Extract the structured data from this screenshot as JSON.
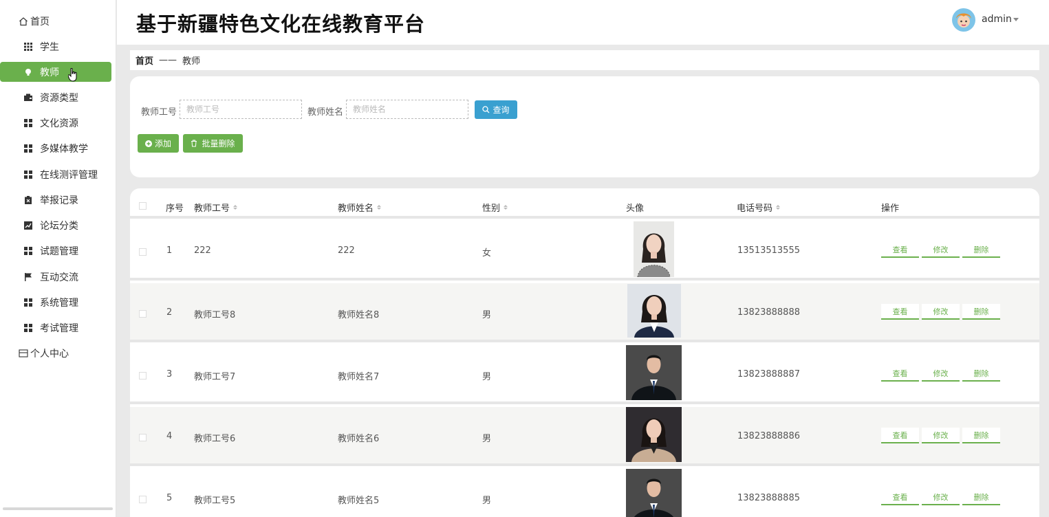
{
  "app": {
    "title": "基于新疆特色文化在线教育平台",
    "username": "admin"
  },
  "sidebar": {
    "items": [
      {
        "label": "首页",
        "icon": "home-icon"
      },
      {
        "label": "学生",
        "icon": "grid-icon"
      },
      {
        "label": "教师",
        "icon": "bulb-icon",
        "active": true
      },
      {
        "label": "资源类型",
        "icon": "wallet-icon"
      },
      {
        "label": "文化资源",
        "icon": "apps-icon"
      },
      {
        "label": "多媒体教学",
        "icon": "apps-icon"
      },
      {
        "label": "在线测评管理",
        "icon": "apps-icon"
      },
      {
        "label": "举报记录",
        "icon": "clipboard-icon"
      },
      {
        "label": "论坛分类",
        "icon": "chart-icon"
      },
      {
        "label": "试题管理",
        "icon": "apps-icon"
      },
      {
        "label": "互动交流",
        "icon": "flag-icon"
      },
      {
        "label": "系统管理",
        "icon": "apps-icon"
      },
      {
        "label": "考试管理",
        "icon": "apps-icon"
      },
      {
        "label": "个人中心",
        "icon": "id-card-icon"
      }
    ]
  },
  "breadcrumb": {
    "home": "首页",
    "separator": "——",
    "current": "教师"
  },
  "search": {
    "id_label": "教师工号",
    "id_placeholder": "教师工号",
    "id_value": "",
    "name_label": "教师姓名",
    "name_placeholder": "教师姓名",
    "name_value": "",
    "query_label": "查询"
  },
  "actions": {
    "add_label": "添加",
    "batch_delete_label": "批量删除"
  },
  "table": {
    "headers": {
      "index": "序号",
      "id": "教师工号",
      "name": "教师姓名",
      "gender": "性别",
      "avatar": "头像",
      "phone": "电话号码",
      "ops": "操作"
    },
    "op_labels": {
      "view": "查看",
      "edit": "修改",
      "delete": "删除"
    },
    "rows": [
      {
        "index": "1",
        "id": "222",
        "name": "222",
        "gender": "女",
        "phone": "13513513555"
      },
      {
        "index": "2",
        "id": "教师工号8",
        "name": "教师姓名8",
        "gender": "男",
        "phone": "13823888888"
      },
      {
        "index": "3",
        "id": "教师工号7",
        "name": "教师姓名7",
        "gender": "男",
        "phone": "13823888887"
      },
      {
        "index": "4",
        "id": "教师工号6",
        "name": "教师姓名6",
        "gender": "男",
        "phone": "13823888886"
      },
      {
        "index": "5",
        "id": "教师工号5",
        "name": "教师姓名5",
        "gender": "男",
        "phone": "13823888885"
      }
    ]
  },
  "colors": {
    "accent": "#6ab04c",
    "query": "#3aa0d0"
  }
}
